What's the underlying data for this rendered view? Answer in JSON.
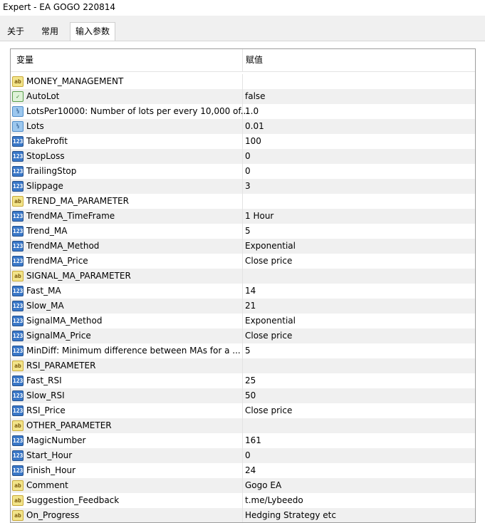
{
  "window": {
    "title": "Expert - EA GOGO 220814"
  },
  "tabs": [
    {
      "label": "关于"
    },
    {
      "label": "常用"
    },
    {
      "label": "输入参数"
    }
  ],
  "table": {
    "headers": {
      "name": "变量",
      "value": "赋值"
    },
    "rows": [
      {
        "icon": "ab",
        "name": "MONEY_MANAGEMENT",
        "value": ""
      },
      {
        "icon": "bool",
        "name": "AutoLot",
        "value": "false"
      },
      {
        "icon": "dbl",
        "name": "LotsPer10000: Number of lots per every 10,000 of...",
        "value": "1.0"
      },
      {
        "icon": "dbl",
        "name": "Lots",
        "value": "0.01"
      },
      {
        "icon": "num",
        "name": "TakeProfit",
        "value": "100"
      },
      {
        "icon": "num",
        "name": "StopLoss",
        "value": "0"
      },
      {
        "icon": "num",
        "name": "TrailingStop",
        "value": "0"
      },
      {
        "icon": "num",
        "name": "Slippage",
        "value": "3"
      },
      {
        "icon": "ab",
        "name": "TREND_MA_PARAMETER",
        "value": ""
      },
      {
        "icon": "num",
        "name": "TrendMA_TimeFrame",
        "value": "1 Hour"
      },
      {
        "icon": "num",
        "name": "Trend_MA",
        "value": "5"
      },
      {
        "icon": "num",
        "name": "TrendMA_Method",
        "value": "Exponential"
      },
      {
        "icon": "num",
        "name": "TrendMA_Price",
        "value": "Close price"
      },
      {
        "icon": "ab",
        "name": "SIGNAL_MA_PARAMETER",
        "value": ""
      },
      {
        "icon": "num",
        "name": "Fast_MA",
        "value": "14"
      },
      {
        "icon": "num",
        "name": "Slow_MA",
        "value": "21"
      },
      {
        "icon": "num",
        "name": "SignalMA_Method",
        "value": "Exponential"
      },
      {
        "icon": "num",
        "name": "SignalMA_Price",
        "value": "Close price"
      },
      {
        "icon": "num",
        "name": "MinDiff: Minimum difference between MAs for a ...",
        "value": "5"
      },
      {
        "icon": "ab",
        "name": "RSI_PARAMETER",
        "value": ""
      },
      {
        "icon": "num",
        "name": "Fast_RSI",
        "value": "25"
      },
      {
        "icon": "num",
        "name": "Slow_RSI",
        "value": "50"
      },
      {
        "icon": "num",
        "name": "RSI_Price",
        "value": "Close price"
      },
      {
        "icon": "ab",
        "name": "OTHER_PARAMETER",
        "value": ""
      },
      {
        "icon": "num",
        "name": "MagicNumber",
        "value": "161"
      },
      {
        "icon": "num",
        "name": "Start_Hour",
        "value": "0"
      },
      {
        "icon": "num",
        "name": "Finish_Hour",
        "value": "24"
      },
      {
        "icon": "ab",
        "name": "Comment",
        "value": "Gogo EA"
      },
      {
        "icon": "ab",
        "name": "Suggestion_Feedback",
        "value": "t.me/Lybeedo"
      },
      {
        "icon": "ab",
        "name": "On_Progress",
        "value": "Hedging Strategy etc"
      }
    ]
  },
  "icon_glyphs": {
    "ab": "ab",
    "num": "123",
    "dbl": "½",
    "bool": "✓"
  }
}
